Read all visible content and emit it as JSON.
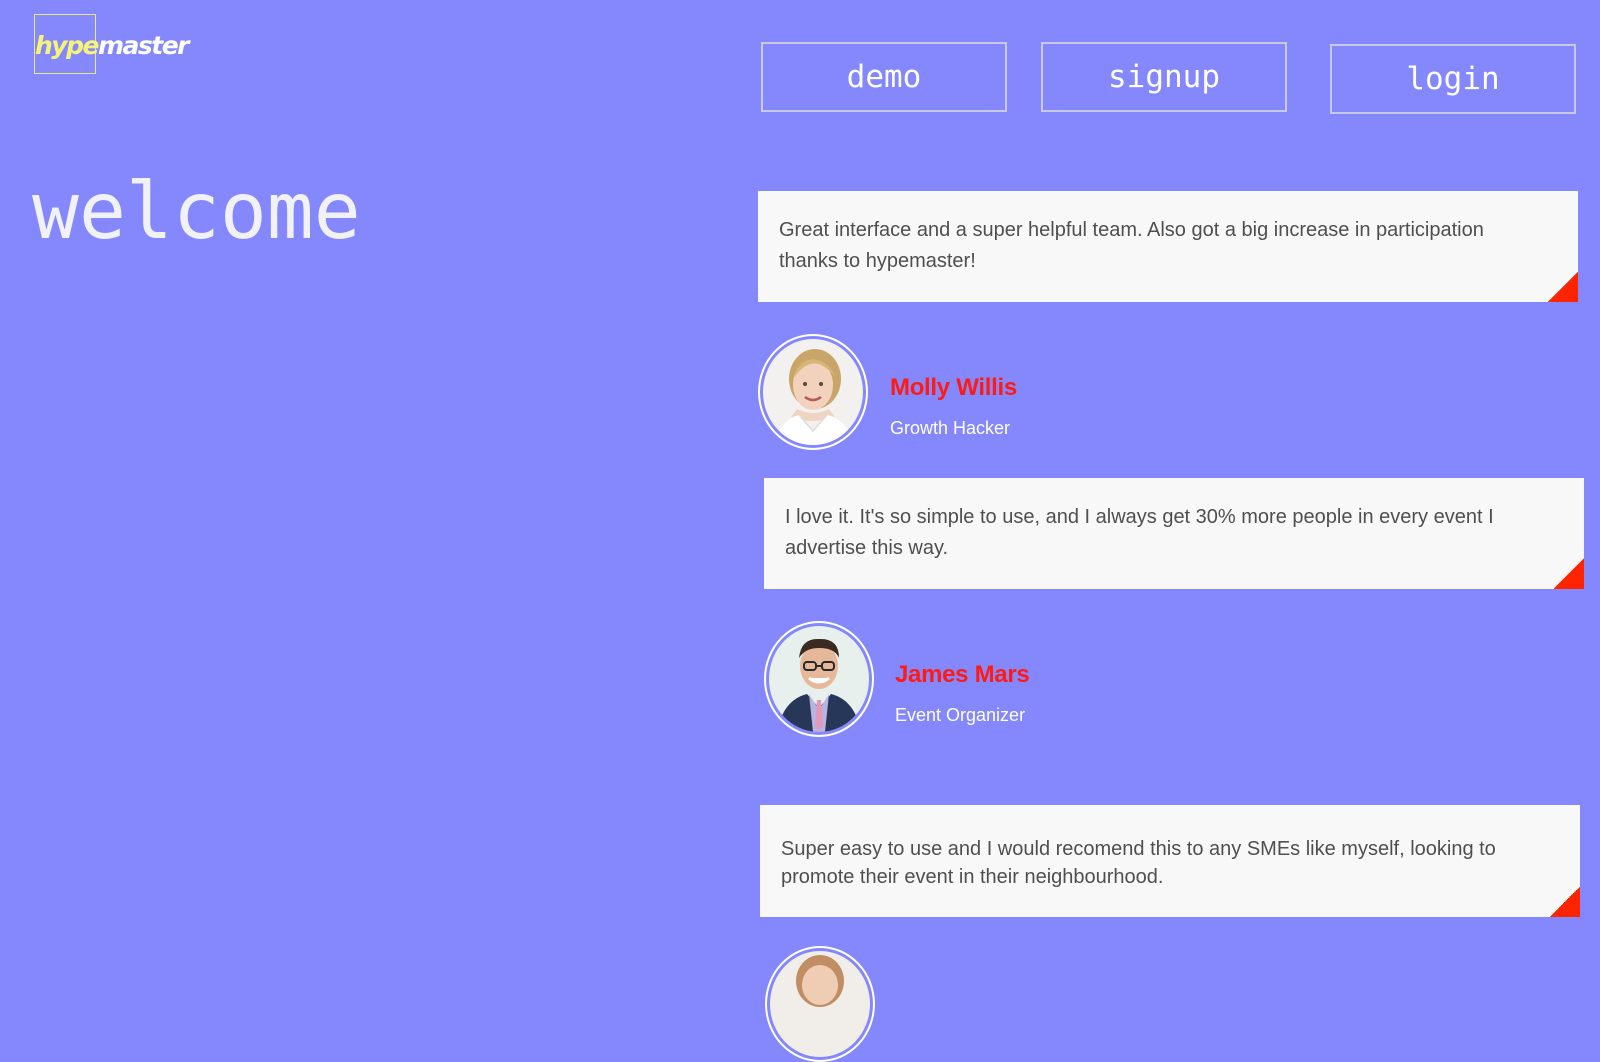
{
  "brand": {
    "logo_part1": "hype",
    "logo_part2": "master"
  },
  "nav": {
    "demo_label": "demo",
    "signup_label": "signup",
    "login_label": "login"
  },
  "hero": {
    "welcome": "welcome"
  },
  "testimonials": [
    {
      "quote": "Great interface and a super helpful team. Also got a big increase in participation thanks to hypemaster!",
      "name": "Molly Willis",
      "role": "Growth Hacker"
    },
    {
      "quote": "I love it. It's so simple to use, and I always get 30% more people in every event I advertise this way.",
      "name": "James Mars",
      "role": "Event Organizer"
    },
    {
      "quote": "Super easy to use and I would recomend this to any SMEs like myself, looking to promote their event in their neighbourhood."
    }
  ],
  "colors": {
    "background": "#8488fc",
    "accent_red": "#ff1a14",
    "logo_yellow": "#f6f37a",
    "card_bg": "#f8f8f8"
  }
}
